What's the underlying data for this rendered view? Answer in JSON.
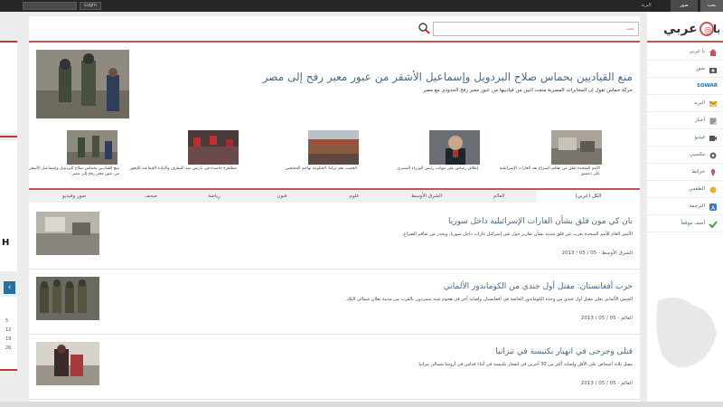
{
  "topbar": {
    "login_label": "Login",
    "tabs": [
      {
        "label": "بحث",
        "active": true
      },
      {
        "label": "صور",
        "active": true
      },
      {
        "label": "البريد",
        "active": false
      }
    ]
  },
  "search": {
    "placeholder": "بحث"
  },
  "featured": {
    "title": "منع القياديين بحماس صلاح البردويل وإسماعيل الأشقر من عبور معبر رفح إلى مصر",
    "summary": "حركة حماس تقول إن المخابرات المصرية منعت اثنين من قيادييها من عبور معبر رفح الحدودي مع مصر"
  },
  "thumbnails": [
    {
      "caption": "الأمم المتحدة تقلق من تفاقم الصراع بعد الغارات الإسرائيلية على دمشق"
    },
    {
      "caption": "إطلاق رصاص على موكب رئيس الوزراء المصري"
    },
    {
      "caption": "الغضب يعم تركيا: الحكومة تهاجم المحتجين"
    },
    {
      "caption": "مظاهرة حاشدة في باريس ضد التطرف والإبادة الجماعية للإيغور"
    },
    {
      "caption": "منع القياديين بحماس صلاح البردويل وإسماعيل الأشقر من عبور معبر رفح إلى مصر"
    }
  ],
  "tabs": [
    {
      "label": "الكل (عربي)",
      "active": true
    },
    {
      "label": "العالم",
      "active": false
    },
    {
      "label": "الشرق الأوسط",
      "active": false
    },
    {
      "label": "علوم",
      "active": false
    },
    {
      "label": "فنون",
      "active": false
    },
    {
      "label": "رياضة",
      "active": false
    },
    {
      "label": "صحف",
      "active": false
    },
    {
      "label": "صور وفيديو",
      "active": false
    }
  ],
  "articles": [
    {
      "title": "بان كي مون قلق بشأن الغارات الإسرائيلية داخل سوريا",
      "summary": "الأمين العام للأمم المتحدة يعرب عن قلق شديد بشأن تقارير حول شن إسرائيل غارات داخل سوريا، ويحذر من تفاقم الصراع.",
      "meta": "الشرق الأوسط - 05 / 05 / 2013"
    },
    {
      "title": "حرب أفغانستان: مقتل أول جندي من الكوماندوز الألماني",
      "summary": "الجيش الألماني يعلن مقتل أول جندي من وحدة الكوماندوز الخاصة في أفغانستان وإصابة آخر في هجوم شنه متمردون بالقرب من مدينة بغلان شمالي البلاد.",
      "meta": "العالم - 05 / 05 / 2013"
    },
    {
      "title": "قتلى وجرحى في انهيار بكنيسة في تنزانيا",
      "summary": "مقتل ثلاثة أشخاص على الأقل وإصابة أكثر من 30 آخرين في انفجار بكنيسة في أثناء قداس في أروشا شمالي تنزانيا.",
      "meta": "العالم - 05 / 05 / 2013"
    }
  ],
  "sidebar": {
    "logo_text": "عربي",
    "items": [
      {
        "label": "يا عربي",
        "icon": "house-icon"
      },
      {
        "label": "صور",
        "icon": "camera-icon"
      },
      {
        "label": "SOWAR",
        "icon": "sowar-logo-icon"
      },
      {
        "label": "البريد",
        "icon": "mail-icon"
      },
      {
        "label": "أخبار",
        "icon": "news-icon"
      },
      {
        "label": "فيديو",
        "icon": "video-icon"
      },
      {
        "label": "مكسبي",
        "icon": "gear-icon"
      },
      {
        "label": "خرائط",
        "icon": "map-icon"
      },
      {
        "label": "الطقس",
        "icon": "weather-icon"
      },
      {
        "label": "الترجمة",
        "icon": "translate-icon"
      },
      {
        "label": "أضف موقعاً",
        "icon": "checkmark-icon"
      }
    ]
  },
  "left_column": {
    "numbers": [
      "5",
      "12",
      "19",
      "26"
    ]
  },
  "colors": {
    "accent_red": "#c4545a",
    "link_blue": "#4a6a8a",
    "topbar": "#262626"
  }
}
